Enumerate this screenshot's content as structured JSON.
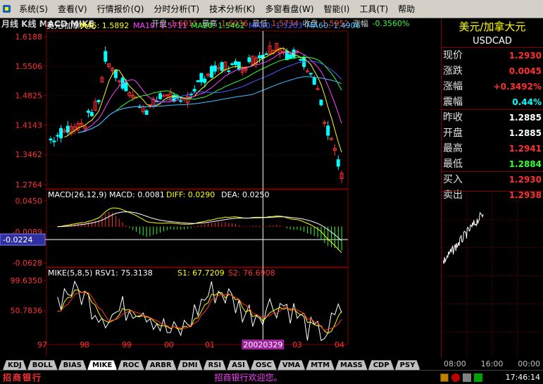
{
  "menubar": {
    "items": [
      "系统(S)",
      "查看(V)",
      "行情报价(Q)",
      "分时分析(T)",
      "技术分析(K)",
      "多窗看盘(W)",
      "智能(I)",
      "工具(T)",
      "帮助"
    ]
  },
  "chart": {
    "title": "月线 K线 MACD MIKE",
    "ohlc": {
      "open_label": "开盘",
      "open": "1.6015",
      "high_label": "最高",
      "high": "1.6036",
      "low_label": "最低",
      "low": "1.5734",
      "close_label": "收盘",
      "close": "1.5952",
      "chg_label": "涨幅",
      "chg": "-0.3560%"
    },
    "ma_legend": [
      {
        "label": "美元/加拿大元",
        "color": "#ffffff"
      },
      {
        "label": "MA5: 1.5892",
        "color": "#ffff00"
      },
      {
        "label": "MA10: 1.5711",
        "color": "#ff40ff"
      },
      {
        "label": "MA20: 1.5462",
        "color": "#30ff30"
      },
      {
        "label": "MA30: 1.5203",
        "color": "#4060ff"
      },
      {
        "label": "MA60: 1.4906",
        "color": "#40c0ff"
      }
    ],
    "price_axis": [
      "1.6188",
      "1.5506",
      "1.4825",
      "1.4143",
      "1.3462",
      "1.2764"
    ],
    "macd_legend": [
      {
        "label": "MACD(26,12,9) MACD: 0.0081",
        "color": "#ffffff"
      },
      {
        "label": "DIFF: 0.0290",
        "color": "#ffff00"
      },
      {
        "label": "DEA: 0.0250",
        "color": "#ffffff"
      }
    ],
    "macd_axis": [
      "0.0450",
      "-0.0089",
      "-0.0628"
    ],
    "macd_cursor_value": "-0.0224",
    "mike_legend": [
      {
        "label": "MIKE(5,8,5) RSV1: 75.3138",
        "color": "#ffffff"
      },
      {
        "label": "S1: 67.7209",
        "color": "#ffff00"
      },
      {
        "label": "S2: 76.6908",
        "color": "#ff3030"
      }
    ],
    "mike_axis": [
      "99.6350",
      "50.7836"
    ],
    "x_labels": [
      "97",
      "98",
      "99",
      "00",
      "01",
      "02",
      "03",
      "04"
    ],
    "cursor_date": "20020329",
    "colors": {
      "up": "#ff3030",
      "down": "#00ffff",
      "grid": "#800000",
      "axis_text": "#ff3030"
    }
  },
  "chart_data": {
    "type": "candlestick",
    "title": "美元/加拿大元",
    "xlabel": "",
    "ylabel": "",
    "x": [
      "97",
      "98",
      "99",
      "00",
      "01",
      "02",
      "03",
      "04"
    ],
    "ylim": [
      1.2764,
      1.6188
    ],
    "series": [
      {
        "name": "MA5",
        "last": 1.5892
      },
      {
        "name": "MA10",
        "last": 1.5711
      },
      {
        "name": "MA20",
        "last": 1.5462
      },
      {
        "name": "MA30",
        "last": 1.5203
      },
      {
        "name": "MA60",
        "last": 1.4906
      }
    ]
  },
  "quote": {
    "title": "美元/加拿大元",
    "code": "USDCAD",
    "rows": [
      {
        "label": "现价",
        "value": "1.2930",
        "color": "#ff3030"
      },
      {
        "label": "涨跌",
        "value": "0.0045",
        "color": "#ff3030"
      },
      {
        "label": "涨幅",
        "value": "+0.3492%",
        "color": "#ff3030"
      },
      {
        "label": "震幅",
        "value": "0.44%",
        "color": "#00ffff"
      },
      {
        "label": "昨收",
        "value": "1.2885",
        "color": "#ffffff"
      },
      {
        "label": "开盘",
        "value": "1.2885",
        "color": "#ffffff"
      },
      {
        "label": "最高",
        "value": "1.2941",
        "color": "#ff3030"
      },
      {
        "label": "最低",
        "value": "1.2884",
        "color": "#30ff30"
      },
      {
        "label": "买入",
        "value": "1.2930",
        "color": "#ff3030"
      },
      {
        "label": "卖出",
        "value": "1.2938",
        "color": "#ff3030"
      }
    ],
    "time_labels": [
      "08:00",
      "16:00",
      "00:00"
    ]
  },
  "tabs": [
    "KDJ",
    "BOLL",
    "BIAS",
    "MIKE",
    "ROC",
    "ARBR",
    "DMI",
    "RSI",
    "ASI",
    "OSC",
    "VMA",
    "MTM",
    "MASS",
    "CDP",
    "PSY"
  ],
  "active_tab": "MIKE",
  "statusbar": {
    "logo": "招商银行",
    "message": "招商银行欢迎您。",
    "time": "17:46:14"
  }
}
